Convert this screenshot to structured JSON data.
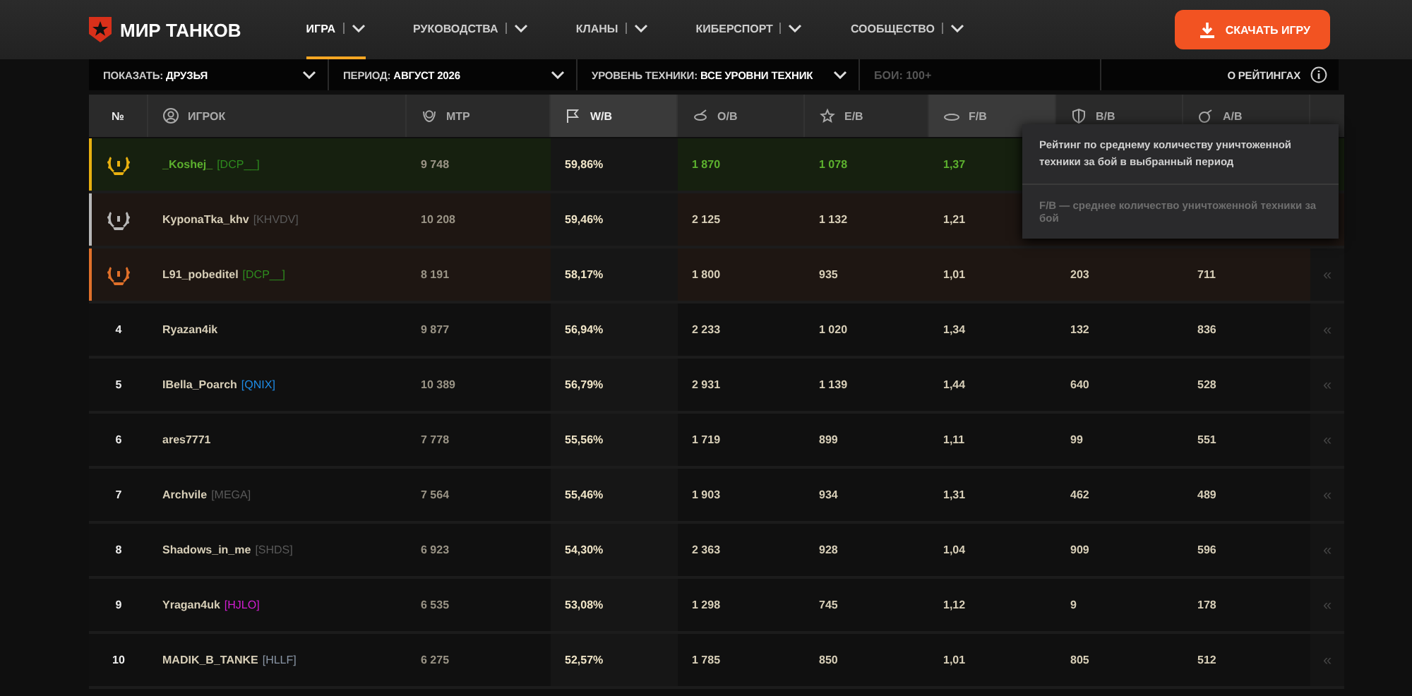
{
  "nav": {
    "logo": "МИР ТАНКОВ",
    "items": [
      {
        "label": "ИГРА",
        "selected": true
      },
      {
        "label": "РУКОВОДСТВА",
        "selected": false
      },
      {
        "label": "КЛАНЫ",
        "selected": false
      },
      {
        "label": "КИБЕРСПОРТ",
        "selected": false
      },
      {
        "label": "СООБЩЕСТВО",
        "selected": false
      }
    ],
    "download_button": "СКАЧАТЬ ИГРУ"
  },
  "filters": [
    {
      "label": "ПОКАЗАТЬ:",
      "value": "ДРУЗЬЯ"
    },
    {
      "label": "ПЕРИОД:",
      "value": "АВГУСТ 2026"
    },
    {
      "label": "УРОВЕНЬ ТЕХНИКИ:",
      "value": "ВСЕ УРОВНИ ТЕХНИК"
    }
  ],
  "battles_field": {
    "placeholder": "БОИ: 100+"
  },
  "about_link": "О РЕЙТИНГАХ",
  "table": {
    "columns": [
      {
        "label": "№",
        "selected": false,
        "highlighted": false
      },
      {
        "label": "ИГРОК",
        "selected": false,
        "highlighted": false
      },
      {
        "label": "МТР",
        "selected": false,
        "highlighted": false
      },
      {
        "label": "W/B",
        "selected": true,
        "highlighted": false
      },
      {
        "label": "O/B",
        "selected": false,
        "highlighted": false
      },
      {
        "label": "E/B",
        "selected": false,
        "highlighted": false
      },
      {
        "label": "F/B",
        "selected": false,
        "highlighted": true
      },
      {
        "label": "B/B",
        "selected": false,
        "highlighted": false
      },
      {
        "label": "A/B",
        "selected": false,
        "highlighted": false
      }
    ],
    "rows": [
      {
        "kind": "gold",
        "current": true,
        "player": "_Koshej_",
        "clan": {
          "tag": "[DCP__]",
          "color": "#2e8b1e"
        },
        "mtr": "9 748",
        "values": [
          "59,86%",
          "1 870",
          "1 078",
          "1,37"
        ]
      },
      {
        "kind": "silver",
        "current": false,
        "player": "KyponaTka_khv",
        "clan": {
          "tag": "[KHVDV]",
          "color": "#595959"
        },
        "mtr": "10 208",
        "values": [
          "59,46%",
          "2 125",
          "1 132",
          "1,21"
        ]
      },
      {
        "kind": "bronze",
        "current": false,
        "player": "L91_pobeditel",
        "clan": {
          "tag": "[DCP__]",
          "color": "#2e8b1e"
        },
        "mtr": "8 191",
        "values": [
          "58,17%",
          "1 800",
          "935",
          "1,01",
          "203",
          "711"
        ],
        "expander": "«"
      },
      {
        "kind": "plain",
        "place": "4",
        "current": false,
        "player": "Ryazan4ik",
        "mtr": "9 877",
        "values": [
          "56,94%",
          "2 233",
          "1 020",
          "1,34",
          "132",
          "836"
        ],
        "expander": "«"
      },
      {
        "kind": "plain",
        "place": "5",
        "current": false,
        "player": "IBella_Poarch",
        "clan": {
          "tag": "[QNIX]",
          "color": "#1e8ce6"
        },
        "mtr": "10 389",
        "values": [
          "56,79%",
          "2 931",
          "1 139",
          "1,44",
          "640",
          "528"
        ],
        "expander": "«"
      },
      {
        "kind": "plain",
        "place": "6",
        "current": false,
        "player": "ares7771",
        "mtr": "7 778",
        "values": [
          "55,56%",
          "1 719",
          "899",
          "1,11",
          "99",
          "551"
        ],
        "expander": "«"
      },
      {
        "kind": "plain",
        "place": "7",
        "current": false,
        "player": "Archvile",
        "clan": {
          "tag": "[MEGA]",
          "color": "#595959"
        },
        "mtr": "7 564",
        "values": [
          "55,46%",
          "1 903",
          "934",
          "1,31",
          "462",
          "489"
        ],
        "expander": "«"
      },
      {
        "kind": "plain",
        "place": "8",
        "current": false,
        "player": "Shadows_in_me",
        "clan": {
          "tag": "[SHDS]",
          "color": "#595959"
        },
        "mtr": "6 923",
        "values": [
          "54,30%",
          "2 363",
          "928",
          "1,04",
          "909",
          "596"
        ],
        "expander": "«"
      },
      {
        "kind": "plain",
        "place": "9",
        "current": false,
        "player": "Yragan4uk",
        "clan": {
          "tag": "[HJLO]",
          "color": "#d21ed2"
        },
        "mtr": "6 535",
        "values": [
          "53,08%",
          "1 298",
          "745",
          "1,12",
          "9",
          "178"
        ],
        "expander": "«"
      },
      {
        "kind": "plain",
        "place": "10",
        "current": false,
        "player": "MADIK_B_TANKE",
        "clan": {
          "tag": "[HLLF]",
          "color": "#8a96a6"
        },
        "mtr": "6 275",
        "values": [
          "52,57%",
          "1 785",
          "850",
          "1,01",
          "805",
          "512"
        ],
        "expander": "«"
      }
    ]
  },
  "tooltip": {
    "title": "Рейтинг по среднему количеству уничтоженной техники за бой в выбранный период",
    "note": "F/B — среднее количество уничтоженной техники за бой"
  }
}
